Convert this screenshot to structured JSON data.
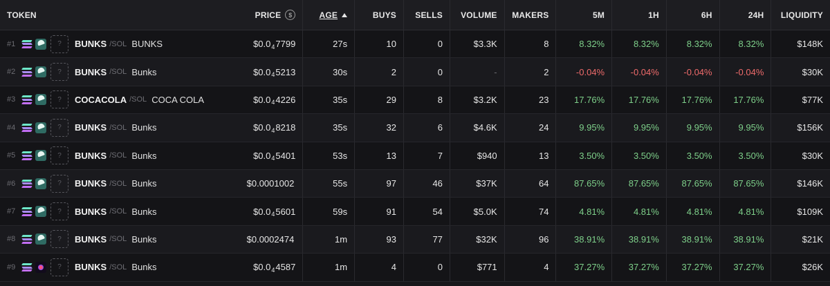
{
  "columns": {
    "token": "TOKEN",
    "price": "PRICE",
    "age": "AGE",
    "buys": "BUYS",
    "sells": "SELLS",
    "volume": "VOLUME",
    "makers": "MAKERS",
    "m5": "5M",
    "h1": "1H",
    "h6": "6H",
    "h24": "24H",
    "liquidity": "LIQUIDITY"
  },
  "price_icon": "dollar-circle-icon",
  "sort_icon": "sort-ascending-icon",
  "image_placeholder": "?",
  "colors": {
    "positive": "#7ed08a",
    "negative": "#ef6b6b",
    "background": "#17171a"
  },
  "rows": [
    {
      "rank": "#1",
      "symbol": "BUNKS",
      "pair": "/SOL",
      "name": "BUNKS",
      "price_a": "$0.0",
      "price_sub": "4",
      "price_b": "7799",
      "age": "27s",
      "buys": "10",
      "sells": "0",
      "volume": "$3.3K",
      "makers": "8",
      "m5": "8.32%",
      "h1": "8.32%",
      "h6": "8.32%",
      "h24": "8.32%",
      "liquidity": "$148K",
      "trend": "pos",
      "dex": "raydium-icon"
    },
    {
      "rank": "#2",
      "symbol": "BUNKS",
      "pair": "/SOL",
      "name": "Bunks",
      "price_a": "$0.0",
      "price_sub": "4",
      "price_b": "5213",
      "age": "30s",
      "buys": "2",
      "sells": "0",
      "volume": "-",
      "makers": "2",
      "m5": "-0.04%",
      "h1": "-0.04%",
      "h6": "-0.04%",
      "h24": "-0.04%",
      "liquidity": "$30K",
      "trend": "neg",
      "dex": "raydium-icon"
    },
    {
      "rank": "#3",
      "symbol": "COCACOLA",
      "pair": "/SOL",
      "name": "COCA COLA",
      "price_a": "$0.0",
      "price_sub": "4",
      "price_b": "4226",
      "age": "35s",
      "buys": "29",
      "sells": "8",
      "volume": "$3.2K",
      "makers": "23",
      "m5": "17.76%",
      "h1": "17.76%",
      "h6": "17.76%",
      "h24": "17.76%",
      "liquidity": "$77K",
      "trend": "pos",
      "dex": "raydium-icon"
    },
    {
      "rank": "#4",
      "symbol": "BUNKS",
      "pair": "/SOL",
      "name": "Bunks",
      "price_a": "$0.0",
      "price_sub": "4",
      "price_b": "8218",
      "age": "35s",
      "buys": "32",
      "sells": "6",
      "volume": "$4.6K",
      "makers": "24",
      "m5": "9.95%",
      "h1": "9.95%",
      "h6": "9.95%",
      "h24": "9.95%",
      "liquidity": "$156K",
      "trend": "pos",
      "dex": "raydium-icon"
    },
    {
      "rank": "#5",
      "symbol": "BUNKS",
      "pair": "/SOL",
      "name": "Bunks",
      "price_a": "$0.0",
      "price_sub": "4",
      "price_b": "5401",
      "age": "53s",
      "buys": "13",
      "sells": "7",
      "volume": "$940",
      "makers": "13",
      "m5": "3.50%",
      "h1": "3.50%",
      "h6": "3.50%",
      "h24": "3.50%",
      "liquidity": "$30K",
      "trend": "pos",
      "dex": "raydium-icon"
    },
    {
      "rank": "#6",
      "symbol": "BUNKS",
      "pair": "/SOL",
      "name": "Bunks",
      "price_a": "$0.0001002",
      "price_sub": "",
      "price_b": "",
      "age": "55s",
      "buys": "97",
      "sells": "46",
      "volume": "$37K",
      "makers": "64",
      "m5": "87.65%",
      "h1": "87.65%",
      "h6": "87.65%",
      "h24": "87.65%",
      "liquidity": "$146K",
      "trend": "pos",
      "dex": "raydium-icon"
    },
    {
      "rank": "#7",
      "symbol": "BUNKS",
      "pair": "/SOL",
      "name": "Bunks",
      "price_a": "$0.0",
      "price_sub": "4",
      "price_b": "5601",
      "age": "59s",
      "buys": "91",
      "sells": "54",
      "volume": "$5.0K",
      "makers": "74",
      "m5": "4.81%",
      "h1": "4.81%",
      "h6": "4.81%",
      "h24": "4.81%",
      "liquidity": "$109K",
      "trend": "pos",
      "dex": "raydium-icon"
    },
    {
      "rank": "#8",
      "symbol": "BUNKS",
      "pair": "/SOL",
      "name": "Bunks",
      "price_a": "$0.0002474",
      "price_sub": "",
      "price_b": "",
      "age": "1m",
      "buys": "93",
      "sells": "77",
      "volume": "$32K",
      "makers": "96",
      "m5": "38.91%",
      "h1": "38.91%",
      "h6": "38.91%",
      "h24": "38.91%",
      "liquidity": "$21K",
      "trend": "pos",
      "dex": "raydium-icon"
    },
    {
      "rank": "#9",
      "symbol": "BUNKS",
      "pair": "/SOL",
      "name": "Bunks",
      "price_a": "$0.0",
      "price_sub": "4",
      "price_b": "4587",
      "age": "1m",
      "buys": "4",
      "sells": "0",
      "volume": "$771",
      "makers": "4",
      "m5": "37.27%",
      "h1": "37.27%",
      "h6": "37.27%",
      "h24": "37.27%",
      "liquidity": "$26K",
      "trend": "pos",
      "dex": "meteora-icon"
    }
  ]
}
